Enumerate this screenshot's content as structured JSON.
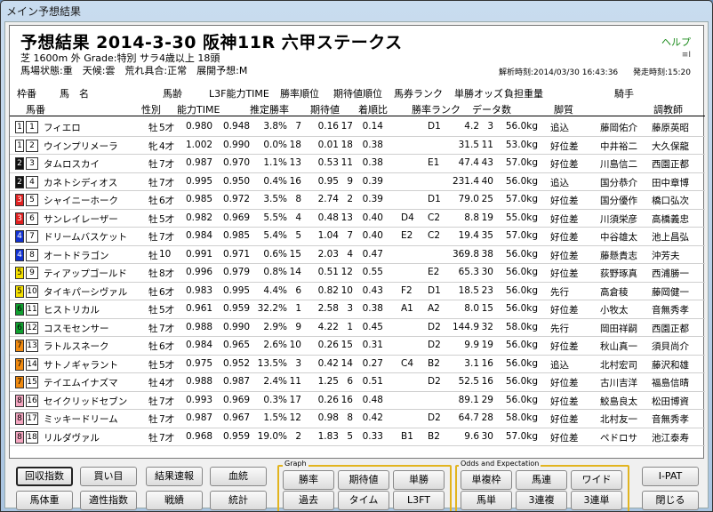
{
  "window": {
    "title": "メイン予想結果"
  },
  "header": {
    "race_title": "予想結果 2014-3-30 阪神11R 六甲ステークス",
    "help": "ヘルプ",
    "icon_text": "≡I",
    "conditions1": "芝 1600m 外 Grade:特別 サラ4歳以上 18頭",
    "conditions2": "馬場状態:重　天候:雲　荒れ具合:正常　展開予想:M",
    "analysis_time": "解析時刻:2014/03/30 16:43:36",
    "start_time": "発走時刻:15:20"
  },
  "columns1": [
    "枠番",
    "馬　名",
    "馬齢",
    "L3F能力TIME",
    "勝率順位",
    "期待値順位",
    "馬券ランク",
    "単勝オッズ",
    "負担重量",
    "騎手"
  ],
  "columns2": [
    "馬番",
    "性別",
    "能力TIME",
    "推定勝率",
    "期待値",
    "着順比",
    "勝率ランク",
    "データ数",
    "脚質",
    "調教師"
  ],
  "rows": [
    {
      "waku": "1",
      "num": "1",
      "name": "フィエロ",
      "sex": "牡",
      "age": "5才",
      "ability": "0.980",
      "l3f": "0.948",
      "winrate": "3.8%",
      "winrank": "7",
      "expect": "0.16",
      "exprank": "17",
      "ratio": "0.14",
      "rank1": "",
      "rank2": "D1",
      "odds": "4.2",
      "data": "3",
      "weight": "56.0kg",
      "style": "追込",
      "jockey": "藤岡佑介",
      "trainer": "藤原英昭"
    },
    {
      "waku": "1",
      "num": "2",
      "name": "ウインプリメーラ",
      "sex": "牝",
      "age": "4才",
      "ability": "1.002",
      "l3f": "0.990",
      "winrate": "0.0%",
      "winrank": "18",
      "expect": "0.01",
      "exprank": "18",
      "ratio": "0.38",
      "rank1": "",
      "rank2": "",
      "odds": "31.5",
      "data": "11",
      "weight": "53.0kg",
      "style": "好位差",
      "jockey": "中井裕二",
      "trainer": "大久保龍"
    },
    {
      "waku": "2",
      "num": "3",
      "name": "タムロスカイ",
      "sex": "牡",
      "age": "7才",
      "ability": "0.987",
      "l3f": "0.970",
      "winrate": "1.1%",
      "winrank": "13",
      "expect": "0.53",
      "exprank": "11",
      "ratio": "0.38",
      "rank1": "",
      "rank2": "E1",
      "odds": "47.4",
      "data": "43",
      "weight": "57.0kg",
      "style": "好位差",
      "jockey": "川島信二",
      "trainer": "西園正都"
    },
    {
      "waku": "2",
      "num": "4",
      "name": "カネトシディオス",
      "sex": "牡",
      "age": "7才",
      "ability": "0.995",
      "l3f": "0.950",
      "winrate": "0.4%",
      "winrank": "16",
      "expect": "0.95",
      "exprank": "9",
      "ratio": "0.39",
      "rank1": "",
      "rank2": "",
      "odds": "231.4",
      "data": "40",
      "weight": "56.0kg",
      "style": "追込",
      "jockey": "国分恭介",
      "trainer": "田中章博"
    },
    {
      "waku": "3",
      "num": "5",
      "name": "シャイニーホーク",
      "sex": "牡",
      "age": "6才",
      "ability": "0.985",
      "l3f": "0.972",
      "winrate": "3.5%",
      "winrank": "8",
      "expect": "2.74",
      "exprank": "2",
      "ratio": "0.39",
      "rank1": "",
      "rank2": "D1",
      "odds": "79.0",
      "data": "25",
      "weight": "57.0kg",
      "style": "好位差",
      "jockey": "国分優作",
      "trainer": "橋口弘次"
    },
    {
      "waku": "3",
      "num": "6",
      "name": "サンレイレーザー",
      "sex": "牡",
      "age": "5才",
      "ability": "0.982",
      "l3f": "0.969",
      "winrate": "5.5%",
      "winrank": "4",
      "expect": "0.48",
      "exprank": "13",
      "ratio": "0.40",
      "rank1": "D4",
      "rank2": "C2",
      "odds": "8.8",
      "data": "19",
      "weight": "55.0kg",
      "style": "好位差",
      "jockey": "川須栄彦",
      "trainer": "高橋義忠"
    },
    {
      "waku": "4",
      "num": "7",
      "name": "ドリームバスケット",
      "sex": "牡",
      "age": "7才",
      "ability": "0.984",
      "l3f": "0.985",
      "winrate": "5.4%",
      "winrank": "5",
      "expect": "1.04",
      "exprank": "7",
      "ratio": "0.40",
      "rank1": "E2",
      "rank2": "C2",
      "odds": "19.4",
      "data": "35",
      "weight": "57.0kg",
      "style": "好位差",
      "jockey": "中谷雄太",
      "trainer": "池上昌弘"
    },
    {
      "waku": "4",
      "num": "8",
      "name": "オートドラゴン",
      "sex": "牡",
      "age": "10",
      "ability": "0.991",
      "l3f": "0.971",
      "winrate": "0.6%",
      "winrank": "15",
      "expect": "2.03",
      "exprank": "4",
      "ratio": "0.47",
      "rank1": "",
      "rank2": "",
      "odds": "369.8",
      "data": "38",
      "weight": "56.0kg",
      "style": "好位差",
      "jockey": "藤懸貴志",
      "trainer": "沖芳夫"
    },
    {
      "waku": "5",
      "num": "9",
      "name": "ティアップゴールド",
      "sex": "牡",
      "age": "8才",
      "ability": "0.996",
      "l3f": "0.979",
      "winrate": "0.8%",
      "winrank": "14",
      "expect": "0.51",
      "exprank": "12",
      "ratio": "0.55",
      "rank1": "",
      "rank2": "E2",
      "odds": "65.3",
      "data": "30",
      "weight": "56.0kg",
      "style": "好位差",
      "jockey": "荻野琢真",
      "trainer": "西浦勝一"
    },
    {
      "waku": "5",
      "num": "10",
      "name": "タイキパーシヴァル",
      "sex": "牡",
      "age": "6才",
      "ability": "0.983",
      "l3f": "0.995",
      "winrate": "4.4%",
      "winrank": "6",
      "expect": "0.82",
      "exprank": "10",
      "ratio": "0.43",
      "rank1": "F2",
      "rank2": "D1",
      "odds": "18.5",
      "data": "23",
      "weight": "56.0kg",
      "style": "先行",
      "jockey": "高倉稜",
      "trainer": "藤岡健一"
    },
    {
      "waku": "6",
      "num": "11",
      "name": "ヒストリカル",
      "sex": "牡",
      "age": "5才",
      "ability": "0.961",
      "l3f": "0.959",
      "winrate": "32.2%",
      "winrank": "1",
      "expect": "2.58",
      "exprank": "3",
      "ratio": "0.38",
      "rank1": "A1",
      "rank2": "A2",
      "odds": "8.0",
      "data": "15",
      "weight": "56.0kg",
      "style": "好位差",
      "jockey": "小牧太",
      "trainer": "音無秀孝"
    },
    {
      "waku": "6",
      "num": "12",
      "name": "コスモセンサー",
      "sex": "牡",
      "age": "7才",
      "ability": "0.988",
      "l3f": "0.990",
      "winrate": "2.9%",
      "winrank": "9",
      "expect": "4.22",
      "exprank": "1",
      "ratio": "0.45",
      "rank1": "",
      "rank2": "D2",
      "odds": "144.9",
      "data": "32",
      "weight": "58.0kg",
      "style": "先行",
      "jockey": "岡田祥嗣",
      "trainer": "西園正都"
    },
    {
      "waku": "7",
      "num": "13",
      "name": "ラトルスネーク",
      "sex": "牡",
      "age": "6才",
      "ability": "0.984",
      "l3f": "0.965",
      "winrate": "2.6%",
      "winrank": "10",
      "expect": "0.26",
      "exprank": "15",
      "ratio": "0.31",
      "rank1": "",
      "rank2": "D2",
      "odds": "9.9",
      "data": "19",
      "weight": "56.0kg",
      "style": "好位差",
      "jockey": "秋山真一",
      "trainer": "須貝尚介"
    },
    {
      "waku": "7",
      "num": "14",
      "name": "サトノギャラント",
      "sex": "牡",
      "age": "5才",
      "ability": "0.975",
      "l3f": "0.952",
      "winrate": "13.5%",
      "winrank": "3",
      "expect": "0.42",
      "exprank": "14",
      "ratio": "0.27",
      "rank1": "C4",
      "rank2": "B2",
      "odds": "3.1",
      "data": "16",
      "weight": "56.0kg",
      "style": "追込",
      "jockey": "北村宏司",
      "trainer": "藤沢和雄"
    },
    {
      "waku": "7",
      "num": "15",
      "name": "テイエムイナズマ",
      "sex": "牡",
      "age": "4才",
      "ability": "0.988",
      "l3f": "0.987",
      "winrate": "2.4%",
      "winrank": "11",
      "expect": "1.25",
      "exprank": "6",
      "ratio": "0.51",
      "rank1": "",
      "rank2": "D2",
      "odds": "52.5",
      "data": "16",
      "weight": "56.0kg",
      "style": "好位差",
      "jockey": "古川吉洋",
      "trainer": "福島信晴"
    },
    {
      "waku": "8",
      "num": "16",
      "name": "セイクリッドセブン",
      "sex": "牡",
      "age": "7才",
      "ability": "0.993",
      "l3f": "0.969",
      "winrate": "0.3%",
      "winrank": "17",
      "expect": "0.26",
      "exprank": "16",
      "ratio": "0.48",
      "rank1": "",
      "rank2": "",
      "odds": "89.1",
      "data": "29",
      "weight": "56.0kg",
      "style": "好位差",
      "jockey": "鮫島良太",
      "trainer": "松田博資"
    },
    {
      "waku": "8",
      "num": "17",
      "name": "ミッキードリーム",
      "sex": "牡",
      "age": "7才",
      "ability": "0.987",
      "l3f": "0.967",
      "winrate": "1.5%",
      "winrank": "12",
      "expect": "0.98",
      "exprank": "8",
      "ratio": "0.42",
      "rank1": "",
      "rank2": "D2",
      "odds": "64.7",
      "data": "28",
      "weight": "58.0kg",
      "style": "好位差",
      "jockey": "北村友一",
      "trainer": "音無秀孝"
    },
    {
      "waku": "8",
      "num": "18",
      "name": "リルダヴァル",
      "sex": "牡",
      "age": "7才",
      "ability": "0.968",
      "l3f": "0.959",
      "winrate": "19.0%",
      "winrank": "2",
      "expect": "1.83",
      "exprank": "5",
      "ratio": "0.33",
      "rank1": "B1",
      "rank2": "B2",
      "odds": "9.6",
      "data": "30",
      "weight": "57.0kg",
      "style": "好位差",
      "jockey": "ペドロサ",
      "trainer": "池江泰寿"
    }
  ],
  "waku_colors": {
    "1": "#ffffff",
    "2": "#111111",
    "3": "#e02020",
    "4": "#1030d0",
    "5": "#f5e000",
    "6": "#10a030",
    "7": "#f08a10",
    "8": "#f4a6c0"
  },
  "buttons_left": [
    "回収指数",
    "買い目",
    "結果速報",
    "血統",
    "馬体重",
    "適性指数",
    "戦績",
    "統計"
  ],
  "graph": {
    "label": "Graph",
    "buttons": [
      "勝率",
      "期待値",
      "単勝",
      "過去",
      "タイム",
      "L3FT"
    ]
  },
  "odds": {
    "label": "Odds and Expectation",
    "buttons": [
      "単複枠",
      "馬連",
      "ワイド",
      "馬単",
      "3連複",
      "3連単"
    ]
  },
  "buttons_right": [
    "I-PAT",
    "閉じる"
  ]
}
